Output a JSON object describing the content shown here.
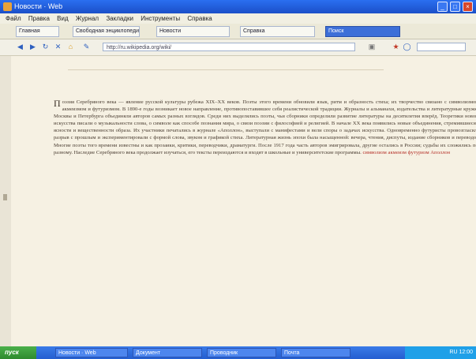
{
  "window": {
    "title": "Новости · Web"
  },
  "menu": [
    "Файл",
    "Правка",
    "Вид",
    "Журнал",
    "Закладки",
    "Инструменты",
    "Справка"
  ],
  "toolbar_tabs": [
    "Главная",
    "Свободная энциклопедия",
    "Новости",
    "Справка",
    "Поиск"
  ],
  "address_bar": {
    "url": "http://ru.wikipedia.org/wiki/"
  },
  "article": {
    "lead_letter": "П",
    "body": "оэзия Серебряного века — явление русской культуры рубежа XIX–XX веков. Поэты этого времени обновили язык, ритм и образность стиха; их творчество связано с символизмом, акмеизмом и футуризмом. В 1890-е годы возникает новое направление, противопоставившее себя реалистической традиции. Журналы и альманахи, издательства и литературные кружки Москвы и Петербурга объединяли авторов самых разных взглядов. Среди них выделялись поэты, чьи сборники определили развитие литературы на десятилетия вперёд. Теоретики нового искусства писали о музыкальности слова, о символе как способе познания мира, о связи поэзии с философией и религией. В начале XX века появились новые объединения, стремившиеся к ясности и вещественности образа. Их участники печатались в журнале «Аполлон», выступали с манифестами и вели споры о задачах искусства. Одновременно футуристы провозгласили разрыв с прошлым и экспериментировали с формой слова, звуком и графикой стиха. Литературная жизнь эпохи была насыщенной: вечера, чтения, диспуты, издание сборников и переводов. Многие поэты того времени известны и как прозаики, критики, переводчики, драматурги. После 1917 года часть авторов эмигрировала, другие остались в России; судьбы их сложились по-разному. Наследие Серебряного века продолжает изучаться, его тексты переиздаются и входят в школьные и университетские программы.",
    "links": [
      "символизм",
      "акмеизм",
      "футуризм",
      "Аполлон"
    ]
  },
  "taskbar": {
    "start_label": "пуск",
    "items": [
      "Новости · Web",
      "Документ",
      "Проводник",
      "Почта"
    ],
    "clock": "RU 12:00"
  }
}
